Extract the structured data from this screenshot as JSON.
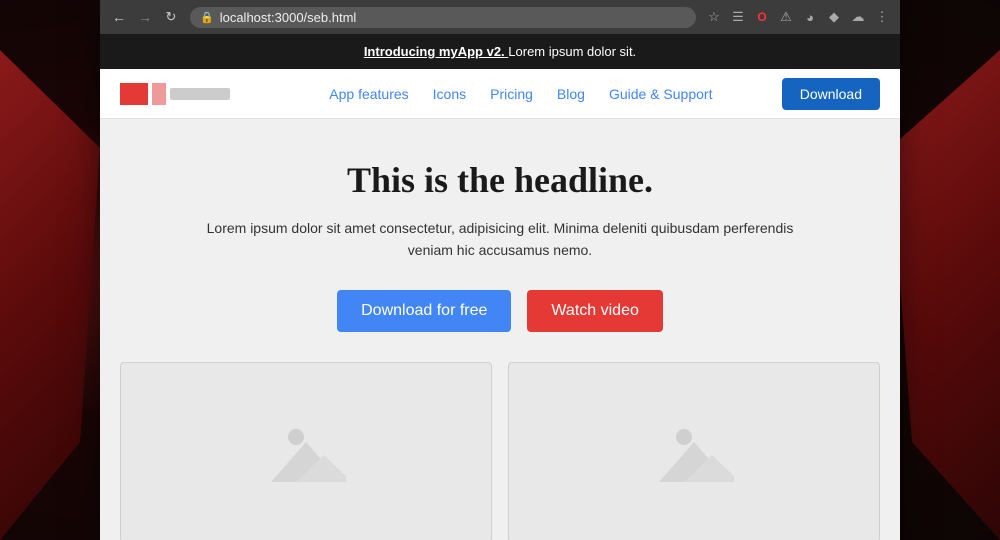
{
  "browser": {
    "url": "localhost:3000/seb.html",
    "back_disabled": false,
    "forward_disabled": true
  },
  "announcement": {
    "text_bold": "Introducing myApp v2.",
    "text_normal": " Lorem ipsum dolor sit."
  },
  "navbar": {
    "links": [
      {
        "label": "App features",
        "id": "app-features"
      },
      {
        "label": "Icons",
        "id": "icons"
      },
      {
        "label": "Pricing",
        "id": "pricing"
      },
      {
        "label": "Blog",
        "id": "blog"
      },
      {
        "label": "Guide & Support",
        "id": "guide-support"
      }
    ],
    "download_label": "Download"
  },
  "hero": {
    "headline": "This is the headline.",
    "subtext": "Lorem ipsum dolor sit amet consectetur, adipisicing elit. Minima deleniti quibusdam perferendis veniam hic accusamus nemo.",
    "btn_download": "Download for free",
    "btn_video": "Watch video"
  },
  "images": [
    {
      "alt": "placeholder-image-1"
    },
    {
      "alt": "placeholder-image-2"
    }
  ]
}
